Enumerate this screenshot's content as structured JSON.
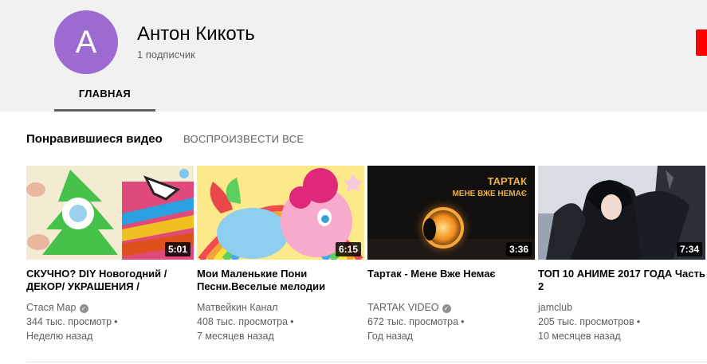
{
  "channel": {
    "avatar_letter": "А",
    "name": "Антон Кикоть",
    "subscribers": "1 подписчик"
  },
  "tabs": [
    {
      "label": "ГЛАВНАЯ"
    }
  ],
  "section": {
    "title": "Понравившиеся видео",
    "play_all": "ВОСПРОИЗВЕСТИ ВСЕ"
  },
  "videos": [
    {
      "duration": "5:01",
      "title": "СКУЧНО? DIY Новогодний / ДЕКОР/ УКРАШЕНИЯ /",
      "channel": "Стася Мар",
      "verified": true,
      "views": "344 тыс. просмотр",
      "age": "Неделю назад"
    },
    {
      "duration": "6:15",
      "title": "Мои Маленькие Пони Песни.Веселые мелодии",
      "channel": "Матвейкин Канал",
      "verified": false,
      "views": "408 тыс. просмотра",
      "age": "7 месяцев назад"
    },
    {
      "duration": "3:36",
      "title": "Тартак - Мене Вже Немає",
      "thumb_text_1": "ТАРТАК",
      "thumb_text_2": "МЕНЕ ВЖЕ НЕМАЄ",
      "channel": "TARTAK VIDEO",
      "verified": true,
      "views": "672 тыс. просмотра",
      "age": "Год назад"
    },
    {
      "duration": "7:34",
      "title": "ТОП 10 АНИМЕ 2017 ГОДА Часть 2",
      "channel": "jamclub",
      "verified": false,
      "views": "205 тыс. просмотров",
      "age": "10 месяцев назад"
    }
  ],
  "colors": {
    "avatar_bg": "#9c6ad0",
    "subscribe_red": "#ff0000",
    "header_bg": "#f1f1f1"
  },
  "icons": {
    "verified": "verified-check-icon",
    "dot_separator": "•"
  }
}
